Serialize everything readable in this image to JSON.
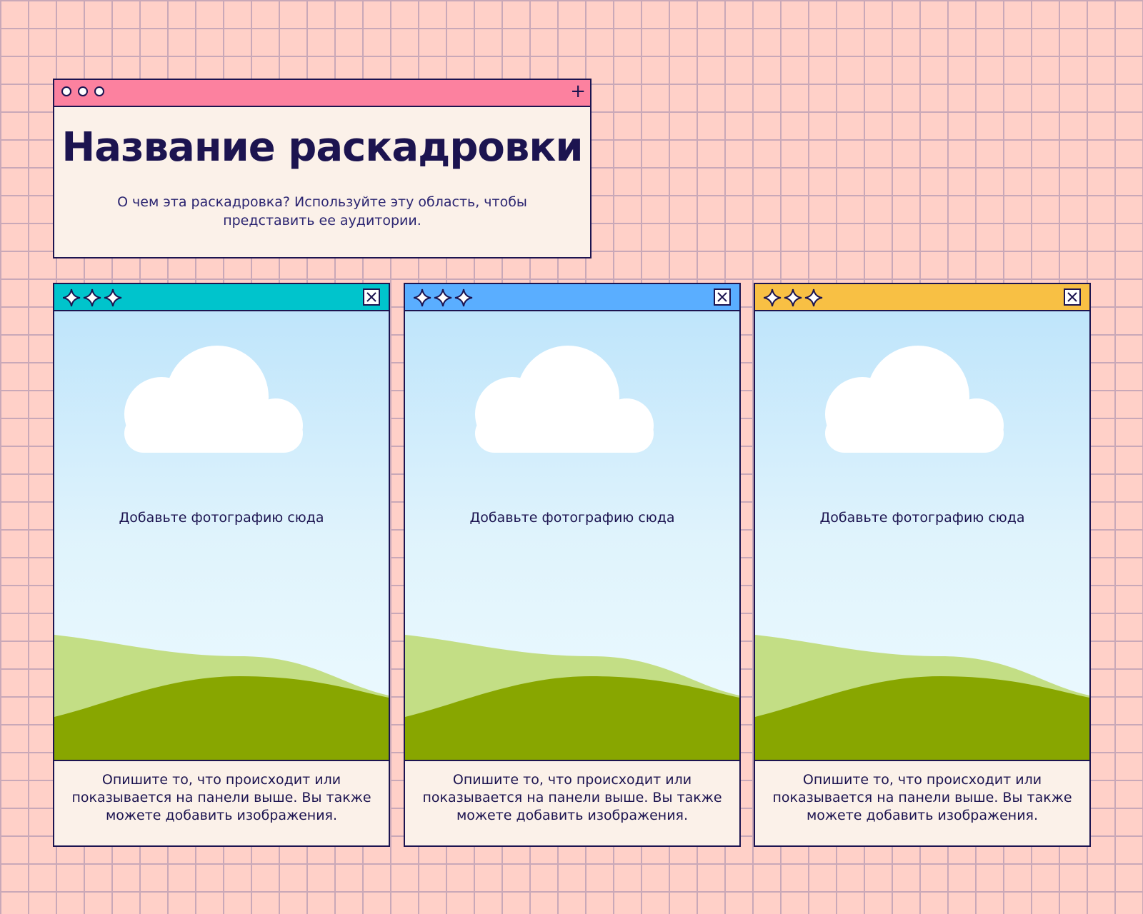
{
  "header_window": {
    "title": "Название раскадровки",
    "subtitle": "О чем эта раскадровка? Используйте эту область, чтобы представить ее аудитории.",
    "bar_color": "#fc819f",
    "plus_symbol": "+",
    "icons": [
      "circle-icon",
      "circle-icon",
      "circle-icon",
      "plus-icon"
    ]
  },
  "panels": [
    {
      "bar_color": "#00c4cc",
      "photo_placeholder": "Добавьте фотографию сюда",
      "caption": "Опишите то, что происходит или показывается на панели выше. Вы также можете добавить изображения."
    },
    {
      "bar_color": "#5aaeff",
      "photo_placeholder": "Добавьте фотографию сюда",
      "caption": "Опишите то, что происходит или показывается на панели выше. Вы также можете добавить изображения."
    },
    {
      "bar_color": "#f8c044",
      "photo_placeholder": "Добавьте фотографию сюда",
      "caption": "Опишите то, что происходит или показывается на панели выше. Вы также можете добавить изображения."
    }
  ],
  "panel_icons": [
    "sparkle-icon",
    "close-icon",
    "cloud-icon"
  ],
  "colors": {
    "background": "#ffd0c8",
    "grid": "#c9a8b8",
    "ink": "#1c1450",
    "window_fill": "#fbf1e9",
    "hill_light": "#c3de85",
    "hill_dark": "#88a600"
  }
}
